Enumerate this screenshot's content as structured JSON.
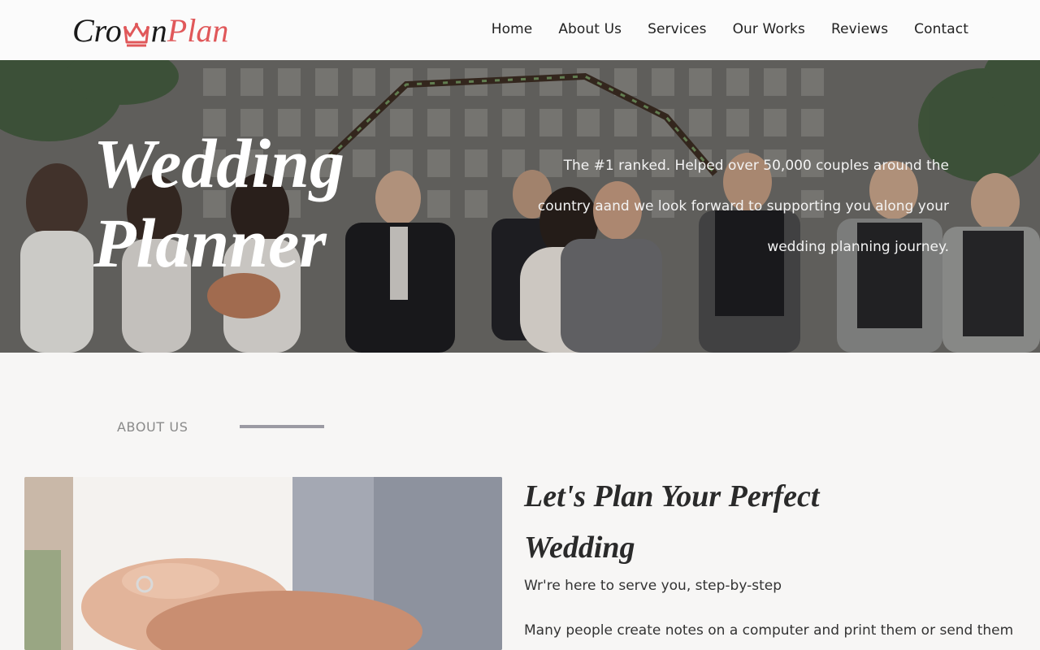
{
  "header": {
    "logo": {
      "part_a": "Cro",
      "part_b": "n",
      "part_c": "Plan",
      "crown_icon": "crown-icon",
      "accent_color": "#e0585a"
    },
    "nav": [
      {
        "label": "Home"
      },
      {
        "label": "About Us"
      },
      {
        "label": "Services"
      },
      {
        "label": "Our Works"
      },
      {
        "label": "Reviews"
      },
      {
        "label": "Contact"
      }
    ]
  },
  "hero": {
    "title_line1": "Wedding",
    "title_line2": "Planner",
    "text": "The #1 ranked. Helped over 50,000 couples around the country aand we look forward to supporting you along your wedding planning journey."
  },
  "about": {
    "label": "ABOUT US",
    "heading_line1": "Let's Plan Your Perfect",
    "heading_line2": "Wedding",
    "subtitle": "Wr're here to serve you, step-by-step",
    "body": "Many people create notes on a computer and print them or send them"
  }
}
